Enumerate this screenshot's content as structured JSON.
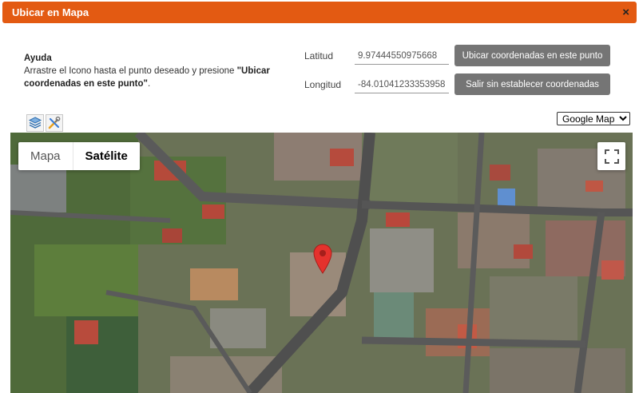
{
  "dialog": {
    "title": "Ubicar en Mapa",
    "close_glyph": "×"
  },
  "help": {
    "heading": "Ayuda",
    "text_before": "Arrastre el Icono hasta el punto deseado y presione ",
    "text_bold": "\"Ubicar coordenadas en este punto\"",
    "text_after": "."
  },
  "coords": {
    "lat_label": "Latitud",
    "lat_value": "9.97444550975668",
    "lng_label": "Longitud",
    "lng_value": "-84.01041233353958"
  },
  "buttons": {
    "locate": "Ubicar coordenadas en este punto",
    "exit": "Salir sin establecer coordenadas"
  },
  "toolbar": {
    "layers_icon": "layers-icon",
    "tools_icon": "tools-icon"
  },
  "provider_select": {
    "options": [
      "Google Maps"
    ],
    "selected": "Google Maps"
  },
  "map": {
    "type_map": "Mapa",
    "type_satellite": "Satélite",
    "active_type": "Satélite",
    "fullscreen_icon": "fullscreen-icon",
    "marker_icon": "map-pin-icon",
    "marker_color": "#e5322d"
  },
  "colors": {
    "titlebar": "#e35a12",
    "button": "#757575"
  }
}
